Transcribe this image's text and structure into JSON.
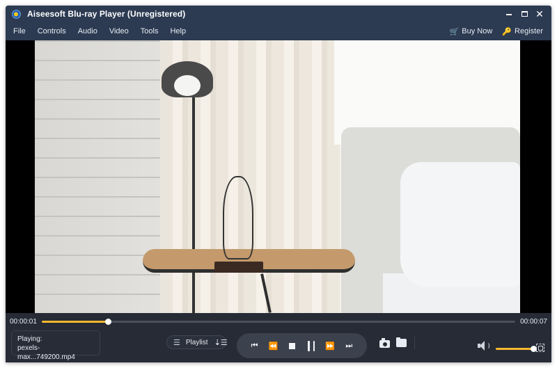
{
  "window": {
    "title": "Aiseesoft Blu-ray Player (Unregistered)",
    "controls": {
      "minimize": "minimize",
      "maximize": "maximize",
      "close": "✕"
    }
  },
  "menu": {
    "items": [
      {
        "label": "File"
      },
      {
        "label": "Controls"
      },
      {
        "label": "Audio"
      },
      {
        "label": "Video"
      },
      {
        "label": "Tools"
      },
      {
        "label": "Help"
      }
    ],
    "buy_now": {
      "label": "Buy Now",
      "icon": "cart-icon",
      "glyph": "🛒"
    },
    "register": {
      "label": "Register",
      "icon": "key-icon",
      "glyph": "🔑"
    }
  },
  "player": {
    "elapsed": "00:00:01",
    "total": "00:00:07",
    "progress_percent": 14,
    "now_playing_label": "Playing:",
    "now_playing_file": "pexels-max...749200.mp4",
    "playlist_label": "Playlist",
    "playlist_icon_glyph": "☰",
    "playlist_sort_glyph": "⇣☰",
    "volume_percent": 100
  },
  "transport": {
    "previous": {
      "icon": "skip-previous-icon",
      "glyph": "⏮"
    },
    "rewind": {
      "icon": "rewind-icon",
      "glyph": "⏪"
    },
    "stop": {
      "icon": "stop-icon"
    },
    "pause": {
      "icon": "pause-icon"
    },
    "forward": {
      "icon": "fast-forward-icon",
      "glyph": "⏩"
    },
    "next": {
      "icon": "skip-next-icon",
      "glyph": "⏭"
    }
  },
  "colors": {
    "titlebar": "#2c3a52",
    "control_bg": "#262b36",
    "accent": "#f5b82e"
  }
}
